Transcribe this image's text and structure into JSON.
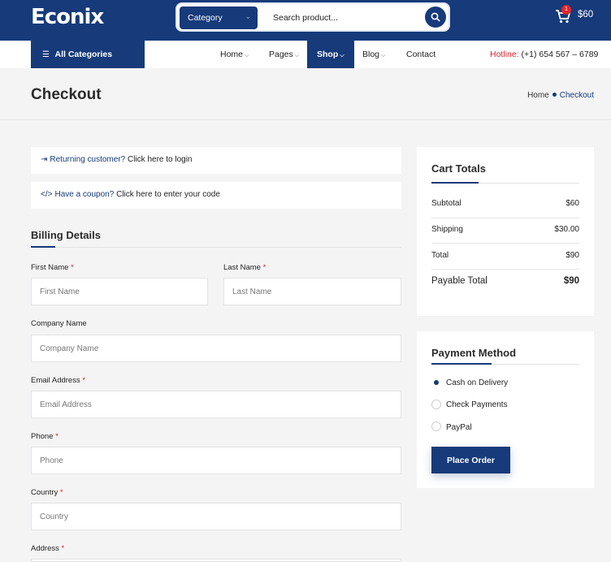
{
  "header": {
    "logo": "Econix",
    "search": {
      "category": "Category",
      "placeholder": "Search product..."
    },
    "cart": {
      "count": "1",
      "total": "$60"
    },
    "icons": {
      "search": "search-icon",
      "cart": "cart-icon"
    },
    "brand_color": "#163a7a"
  },
  "nav": {
    "all_categories": "All Categories",
    "items": [
      {
        "label": "Home",
        "dropdown": true
      },
      {
        "label": "Pages",
        "dropdown": true
      },
      {
        "label": "Shop",
        "dropdown": true,
        "active": true
      },
      {
        "label": "Blog",
        "dropdown": true
      },
      {
        "label": "Contact",
        "dropdown": false
      }
    ],
    "hotline_label": "Hotline:",
    "hotline_number": "(+1) 654 567 – 6789"
  },
  "page": {
    "title": "Checkout",
    "breadcrumb": {
      "home": "Home",
      "current": "Checkout"
    }
  },
  "notices": {
    "login_link": "Returning customer?",
    "login_text": " Click here to login",
    "coupon_link": "Have a coupon?",
    "coupon_text": " Click here to enter your code"
  },
  "billing": {
    "title": "Billing Details",
    "fields": {
      "first_name": {
        "label": "First Name",
        "placeholder": "First Name",
        "required": true
      },
      "last_name": {
        "label": "Last Name",
        "placeholder": "Last Name",
        "required": true
      },
      "company": {
        "label": "Company Name",
        "placeholder": "Company Name",
        "required": false
      },
      "email": {
        "label": "Email Address",
        "placeholder": "Email Address",
        "required": true
      },
      "phone": {
        "label": "Phone",
        "placeholder": "Phone",
        "required": true
      },
      "country": {
        "label": "Country",
        "placeholder": "Country",
        "required": true
      },
      "address": {
        "label": "Address",
        "required": true
      }
    },
    "required_mark": "*"
  },
  "cart_totals": {
    "title": "Cart Totals",
    "subtotal_label": "Subtotal",
    "subtotal": "$60",
    "shipping_label": "Shipping",
    "shipping": "$30.00",
    "total_label": "Total",
    "total": "$90",
    "payable_label": "Payable Total",
    "payable": "$90"
  },
  "payment": {
    "title": "Payment Method",
    "options": [
      {
        "label": "Cash on Delivery",
        "selected": true
      },
      {
        "label": "Check Payments",
        "selected": false
      },
      {
        "label": "PayPal",
        "selected": false
      }
    ],
    "place_order": "Place Order"
  }
}
